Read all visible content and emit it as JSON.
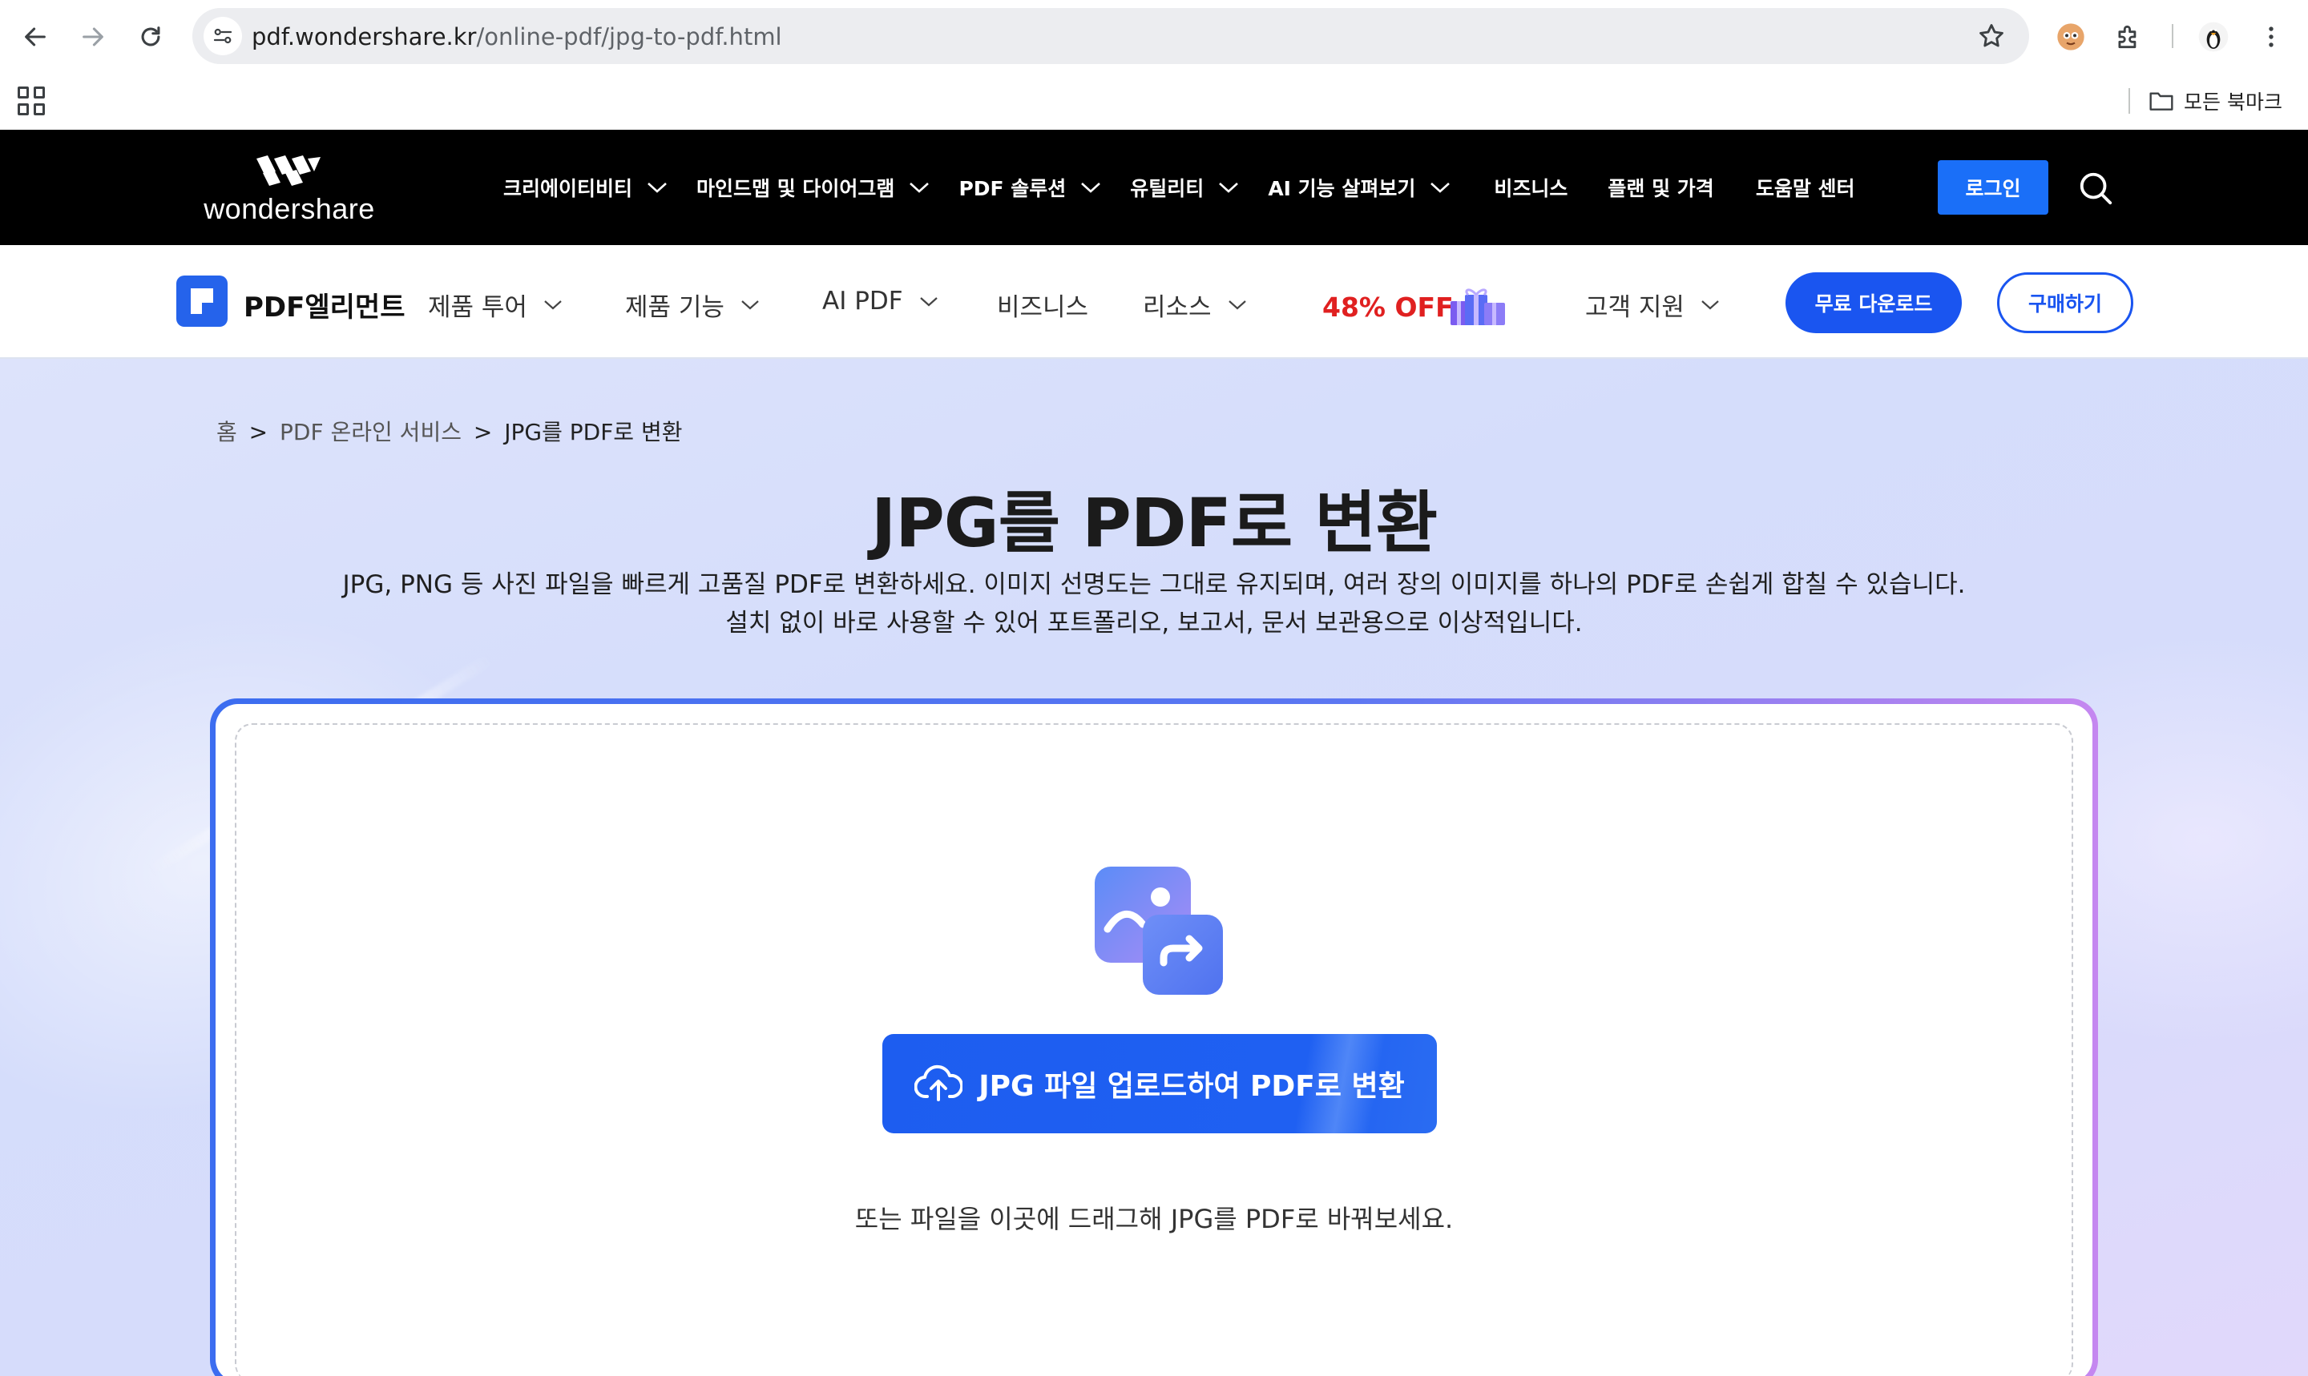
{
  "browser": {
    "url_domain": "pdf.wondershare.kr",
    "url_path": "/online-pdf/jpg-to-pdf.html",
    "all_bookmarks_label": "모든 북마크"
  },
  "site_header": {
    "logo_text": "wondershare",
    "nav": [
      {
        "label": "크리에이티비티",
        "dropdown": true
      },
      {
        "label": "마인드맵 및 다이어그램",
        "dropdown": true
      },
      {
        "label": "PDF 솔루션",
        "dropdown": true
      },
      {
        "label": "유틸리티",
        "dropdown": true
      },
      {
        "label": "AI 기능 살펴보기",
        "dropdown": true
      },
      {
        "label": "비즈니스",
        "dropdown": false
      },
      {
        "label": "플랜 및 가격",
        "dropdown": false
      },
      {
        "label": "도움말 센터",
        "dropdown": false
      }
    ],
    "login_label": "로그인"
  },
  "product_nav": {
    "brand": "PDF엘리먼트",
    "items": [
      {
        "label": "제품 투어"
      },
      {
        "label": "제품 기능"
      },
      {
        "label": "AI PDF"
      },
      {
        "label": "비즈니스"
      },
      {
        "label": "리소스"
      },
      {
        "label": "고객 지원"
      }
    ],
    "promo": "48% OFF",
    "download_label": "무료 다운로드",
    "buy_label": "구매하기"
  },
  "hero": {
    "breadcrumb": {
      "home": "홈",
      "mid": "PDF 온라인 서비스",
      "current": "JPG를 PDF로 변환",
      "separator": ">"
    },
    "title": "JPG를 PDF로 변환",
    "desc_line1": "JPG, PNG 등 사진 파일을 빠르게 고품질 PDF로 변환하세요. 이미지 선명도는 그대로 유지되며, 여러 장의 이미지를 하나의 PDF로 손쉽게 합칠 수 있습니다.",
    "desc_line2": "설치 없이 바로 사용할 수 있어 포트폴리오, 보고서, 문서 보관용으로 이상적입니다.",
    "upload_button": "JPG 파일 업로드하여 PDF로 변환",
    "drop_hint": "또는 파일을 이곳에 드래그해 JPG를 PDF로 바꿔보세요."
  },
  "colors": {
    "accent": "#1a55f0",
    "promo": "#e02020",
    "header_bg": "#000000"
  }
}
